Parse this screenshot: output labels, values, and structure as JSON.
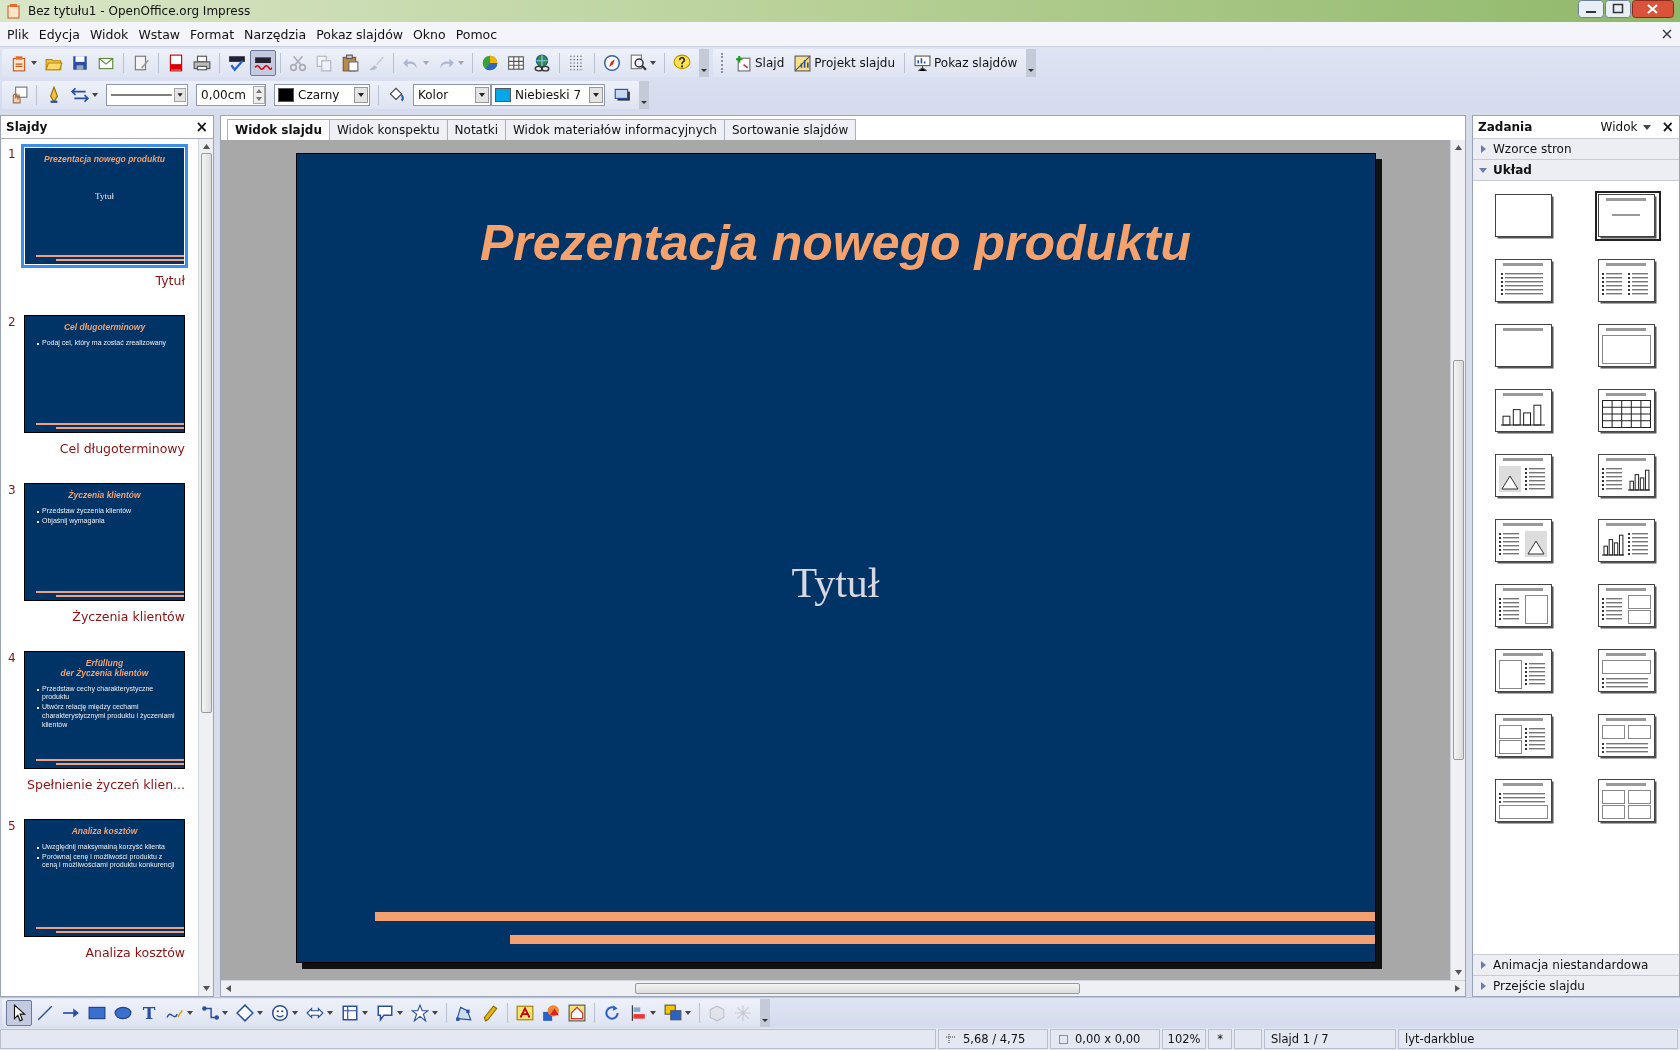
{
  "window": {
    "title": "Bez tytułu1 - OpenOffice.org Impress"
  },
  "menu": [
    "Plik",
    "Edycja",
    "Widok",
    "Wstaw",
    "Format",
    "Narzędzia",
    "Pokaz slajdów",
    "Okno",
    "Pomoc"
  ],
  "standard_toolbar": [
    [
      {
        "kind": "new",
        "dropdown": true,
        "disabled": false,
        "on": false
      },
      {
        "kind": "open",
        "dropdown": false,
        "disabled": false,
        "on": false
      },
      {
        "kind": "save",
        "dropdown": false,
        "disabled": false,
        "on": false
      },
      {
        "kind": "email",
        "dropdown": false,
        "disabled": false,
        "on": false
      }
    ],
    [
      {
        "kind": "edit",
        "dropdown": false,
        "disabled": false,
        "on": false
      }
    ],
    [
      {
        "kind": "pdf",
        "dropdown": false,
        "disabled": false,
        "on": false
      },
      {
        "kind": "print",
        "dropdown": false,
        "disabled": false,
        "on": false
      }
    ],
    [
      {
        "kind": "spellcheck",
        "dropdown": false,
        "disabled": false,
        "on": false
      },
      {
        "kind": "autospell",
        "dropdown": false,
        "disabled": false,
        "on": true
      }
    ],
    [
      {
        "kind": "cut",
        "dropdown": false,
        "disabled": true,
        "on": false
      },
      {
        "kind": "copy",
        "dropdown": false,
        "disabled": true,
        "on": false
      },
      {
        "kind": "paste",
        "dropdown": false,
        "disabled": false,
        "on": false
      },
      {
        "kind": "brush",
        "dropdown": false,
        "disabled": true,
        "on": false
      }
    ],
    [
      {
        "kind": "undo",
        "dropdown": true,
        "disabled": true,
        "on": false
      },
      {
        "kind": "redo",
        "dropdown": true,
        "disabled": true,
        "on": false
      }
    ],
    [
      {
        "kind": "chart",
        "dropdown": false,
        "disabled": false,
        "on": false
      },
      {
        "kind": "table",
        "dropdown": false,
        "disabled": false,
        "on": false
      },
      {
        "kind": "globe",
        "dropdown": false,
        "disabled": false,
        "on": false
      }
    ],
    [
      {
        "kind": "grid",
        "dropdown": false,
        "disabled": false,
        "on": false
      }
    ],
    [
      {
        "kind": "compass",
        "dropdown": false,
        "disabled": false,
        "on": false
      },
      {
        "kind": "zoom",
        "dropdown": true,
        "disabled": false,
        "on": false
      }
    ],
    [
      {
        "kind": "help",
        "dropdown": false,
        "disabled": false,
        "on": false
      }
    ]
  ],
  "presentation_toolbar": [
    {
      "kind": "slide",
      "label": "Slajd"
    },
    {
      "kind": "design",
      "label": "Projekt slajdu"
    },
    {
      "kind": "show",
      "label": "Pokaz slajdów"
    }
  ],
  "line_toolbar": {
    "line_width": "0,00cm",
    "line_color": {
      "label": "Czarny",
      "color": "#000000"
    },
    "area_style": "Kolor",
    "fill": {
      "label": "Niebieski 7",
      "color": "#00a8e8"
    }
  },
  "slides_panel": {
    "title": "Slajdy",
    "close": "×",
    "slides": [
      {
        "number": "1",
        "name": "Tytuł",
        "selected": true,
        "title_lines": [
          "Prezentacja nowego produktu"
        ],
        "subtitle": "Tytuł"
      },
      {
        "number": "2",
        "name": "Cel długoterminowy",
        "selected": false,
        "title_lines": [
          "Cel długoterminowy"
        ],
        "bullets": [
          "Podaj cel, który ma zostać zrealizowany"
        ]
      },
      {
        "number": "3",
        "name": "Życzenia klientów",
        "selected": false,
        "title_lines": [
          "Życzenia klientów"
        ],
        "bullets": [
          "Przedstaw życzenia klientów",
          "Objaśnij wymagania"
        ]
      },
      {
        "number": "4",
        "name": "Spełnienie życzeń klien...",
        "selected": false,
        "title_lines": [
          "Erfüllung",
          "der Życzenia klientów"
        ],
        "bullets": [
          "Przedstaw cechy charakterystyczne produktu",
          "Utwórz relację między cechami charakterystycznymi produktu i życzeniami klientów"
        ]
      },
      {
        "number": "5",
        "name": "Analiza kosztów",
        "selected": false,
        "title_lines": [
          "Analiza kosztów"
        ],
        "bullets": [
          "Uwzględnij maksymalną korzyść klienta",
          "Porównaj cenę i możliwości produktu z ceną i możliwościami produktu konkurencji"
        ]
      }
    ]
  },
  "view_tabs": [
    {
      "label": "Widok slajdu",
      "selected": true
    },
    {
      "label": "Widok konspektu",
      "selected": false
    },
    {
      "label": "Notatki",
      "selected": false
    },
    {
      "label": "Widok materiałów informacyjnych",
      "selected": false
    },
    {
      "label": "Sortowanie slajdów",
      "selected": false
    }
  ],
  "slide": {
    "title": "Prezentacja nowego produktu",
    "subtitle": "Tytuł"
  },
  "tasks_panel": {
    "title": "Zadania",
    "view": "Widok",
    "close": "×",
    "sections_top": [
      {
        "title": "Wzorce stron",
        "expanded": false
      },
      {
        "title": "Układ",
        "expanded": true
      }
    ],
    "layouts": [
      {
        "kind": "blank",
        "selected": false
      },
      {
        "kind": "title-subtitle",
        "selected": true
      },
      {
        "kind": "title-text",
        "selected": false
      },
      {
        "kind": "title-2text",
        "selected": false
      },
      {
        "kind": "title-only",
        "selected": false
      },
      {
        "kind": "title-box",
        "selected": false
      },
      {
        "kind": "title-chart",
        "selected": false
      },
      {
        "kind": "title-table",
        "selected": false
      },
      {
        "kind": "title-clip-text",
        "selected": false
      },
      {
        "kind": "title-text-chart",
        "selected": false
      },
      {
        "kind": "title-text-clip",
        "selected": false
      },
      {
        "kind": "title-chart-text",
        "selected": false
      },
      {
        "kind": "title-text-box",
        "selected": false
      },
      {
        "kind": "title-text-2box",
        "selected": false
      },
      {
        "kind": "title-box-text",
        "selected": false
      },
      {
        "kind": "title-box-over-text",
        "selected": false
      },
      {
        "kind": "title-2box-text",
        "selected": false
      },
      {
        "kind": "title-2box-over-text",
        "selected": false
      },
      {
        "kind": "title-text-over-box",
        "selected": false
      },
      {
        "kind": "title-4box",
        "selected": false
      }
    ],
    "sections_bottom": [
      {
        "title": "Animacja niestandardowa",
        "expanded": false
      },
      {
        "title": "Przejście slajdu",
        "expanded": false
      }
    ]
  },
  "drawing_toolbar": [
    [
      {
        "kind": "select",
        "dropdown": false,
        "disabled": false,
        "on": true
      },
      {
        "kind": "line",
        "dropdown": false,
        "disabled": false,
        "on": false
      },
      {
        "kind": "arrow",
        "dropdown": false,
        "disabled": false,
        "on": false
      },
      {
        "kind": "rect",
        "dropdown": false,
        "disabled": false,
        "on": false
      },
      {
        "kind": "ellipse",
        "dropdown": false,
        "disabled": false,
        "on": false
      },
      {
        "kind": "text",
        "glyph": "T",
        "dropdown": false,
        "disabled": false,
        "on": false
      },
      {
        "kind": "curve",
        "dropdown": true,
        "disabled": false,
        "on": false
      },
      {
        "kind": "connector",
        "dropdown": true,
        "disabled": false,
        "on": false
      },
      {
        "kind": "diamond",
        "dropdown": true,
        "disabled": false,
        "on": false
      },
      {
        "kind": "smiley",
        "dropdown": true,
        "disabled": false,
        "on": false
      },
      {
        "kind": "double-arrow",
        "dropdown": true,
        "disabled": false,
        "on": false
      },
      {
        "kind": "flowchart",
        "dropdown": true,
        "disabled": false,
        "on": false
      },
      {
        "kind": "callout",
        "dropdown": true,
        "disabled": false,
        "on": false
      },
      {
        "kind": "star",
        "dropdown": true,
        "disabled": false,
        "on": false
      }
    ],
    [
      {
        "kind": "points",
        "dropdown": false,
        "disabled": false,
        "on": false
      },
      {
        "kind": "glue",
        "dropdown": false,
        "disabled": false,
        "on": false
      }
    ],
    [
      {
        "kind": "fontwork",
        "dropdown": false,
        "disabled": false,
        "on": false
      },
      {
        "kind": "shapes",
        "dropdown": false,
        "disabled": false,
        "on": false
      },
      {
        "kind": "image",
        "dropdown": false,
        "disabled": false,
        "on": false
      }
    ],
    [
      {
        "kind": "rotate",
        "dropdown": false,
        "disabled": false,
        "on": false
      },
      {
        "kind": "align",
        "dropdown": true,
        "disabled": false,
        "on": false
      },
      {
        "kind": "arrange",
        "dropdown": true,
        "disabled": false,
        "on": false
      }
    ],
    [
      {
        "kind": "extrusion",
        "dropdown": false,
        "disabled": true,
        "on": false
      },
      {
        "kind": "effects",
        "dropdown": false,
        "disabled": true,
        "on": false
      }
    ]
  ],
  "status_bar": {
    "position": "5,68 / 4,75",
    "size": "0,00 x 0,00",
    "zoom": "102%",
    "modified": "*",
    "slide": "Slajd 1 / 7",
    "design": "lyt-darkblue"
  }
}
